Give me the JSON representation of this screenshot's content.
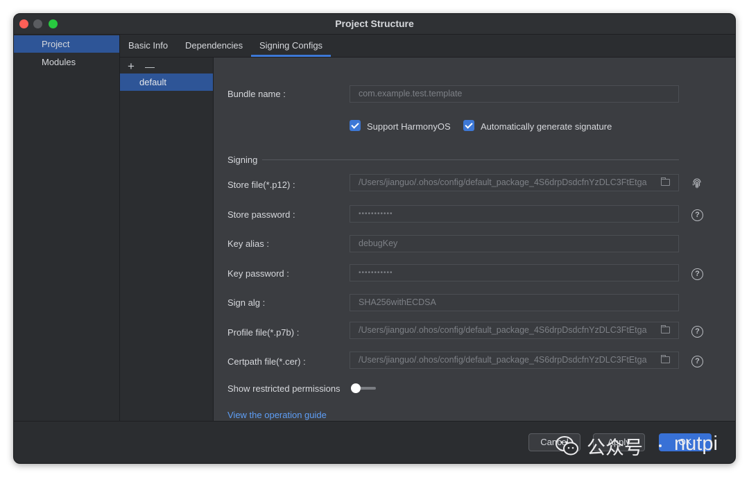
{
  "window": {
    "title": "Project Structure"
  },
  "left_nav": {
    "items": [
      {
        "label": "Project",
        "selected": true
      },
      {
        "label": "Modules",
        "selected": false
      }
    ]
  },
  "tabs": [
    {
      "label": "Basic Info"
    },
    {
      "label": "Dependencies"
    },
    {
      "label": "Signing Configs",
      "active": true
    }
  ],
  "configs": {
    "add": "+",
    "remove": "—",
    "items": [
      {
        "label": "default",
        "selected": true
      }
    ]
  },
  "form": {
    "bundle_name": {
      "label": "Bundle name",
      "value": "com.example.test.template"
    },
    "support_harmonyos": {
      "label": "Support HarmonyOS",
      "checked": true
    },
    "auto_sign": {
      "label": "Automatically generate signature",
      "checked": true
    },
    "signing_section": "Signing",
    "store_file": {
      "label": "Store file(*.p12)",
      "value": "/Users/jianguo/.ohos/config/default_package_4S6drpDsdcfnYzDLC3FtEtga"
    },
    "store_password": {
      "label": "Store password",
      "value": "•••••••••••"
    },
    "key_alias": {
      "label": "Key alias",
      "value": "debugKey"
    },
    "key_password": {
      "label": "Key password",
      "value": "•••••••••••"
    },
    "sign_alg": {
      "label": "Sign alg",
      "value": "SHA256withECDSA"
    },
    "profile_file": {
      "label": "Profile file(*.p7b)",
      "value": "/Users/jianguo/.ohos/config/default_package_4S6drpDsdcfnYzDLC3FtEtga"
    },
    "certpath_file": {
      "label": "Certpath file(*.cer)",
      "value": "/Users/jianguo/.ohos/config/default_package_4S6drpDsdcfnYzDLC3FtEtga"
    },
    "show_restricted": {
      "label": "Show restricted permissions",
      "on": false
    },
    "guide_link": "View the operation guide",
    "help_glyph": "?"
  },
  "footer": {
    "cancel": "Cancel",
    "apply": "Apply",
    "ok": "OK"
  },
  "watermark": {
    "text": "公众号",
    "handle": "nutpi"
  },
  "colors": {
    "accent": "#3d78d6",
    "selection": "#2e5597",
    "link": "#5e9ef5"
  }
}
